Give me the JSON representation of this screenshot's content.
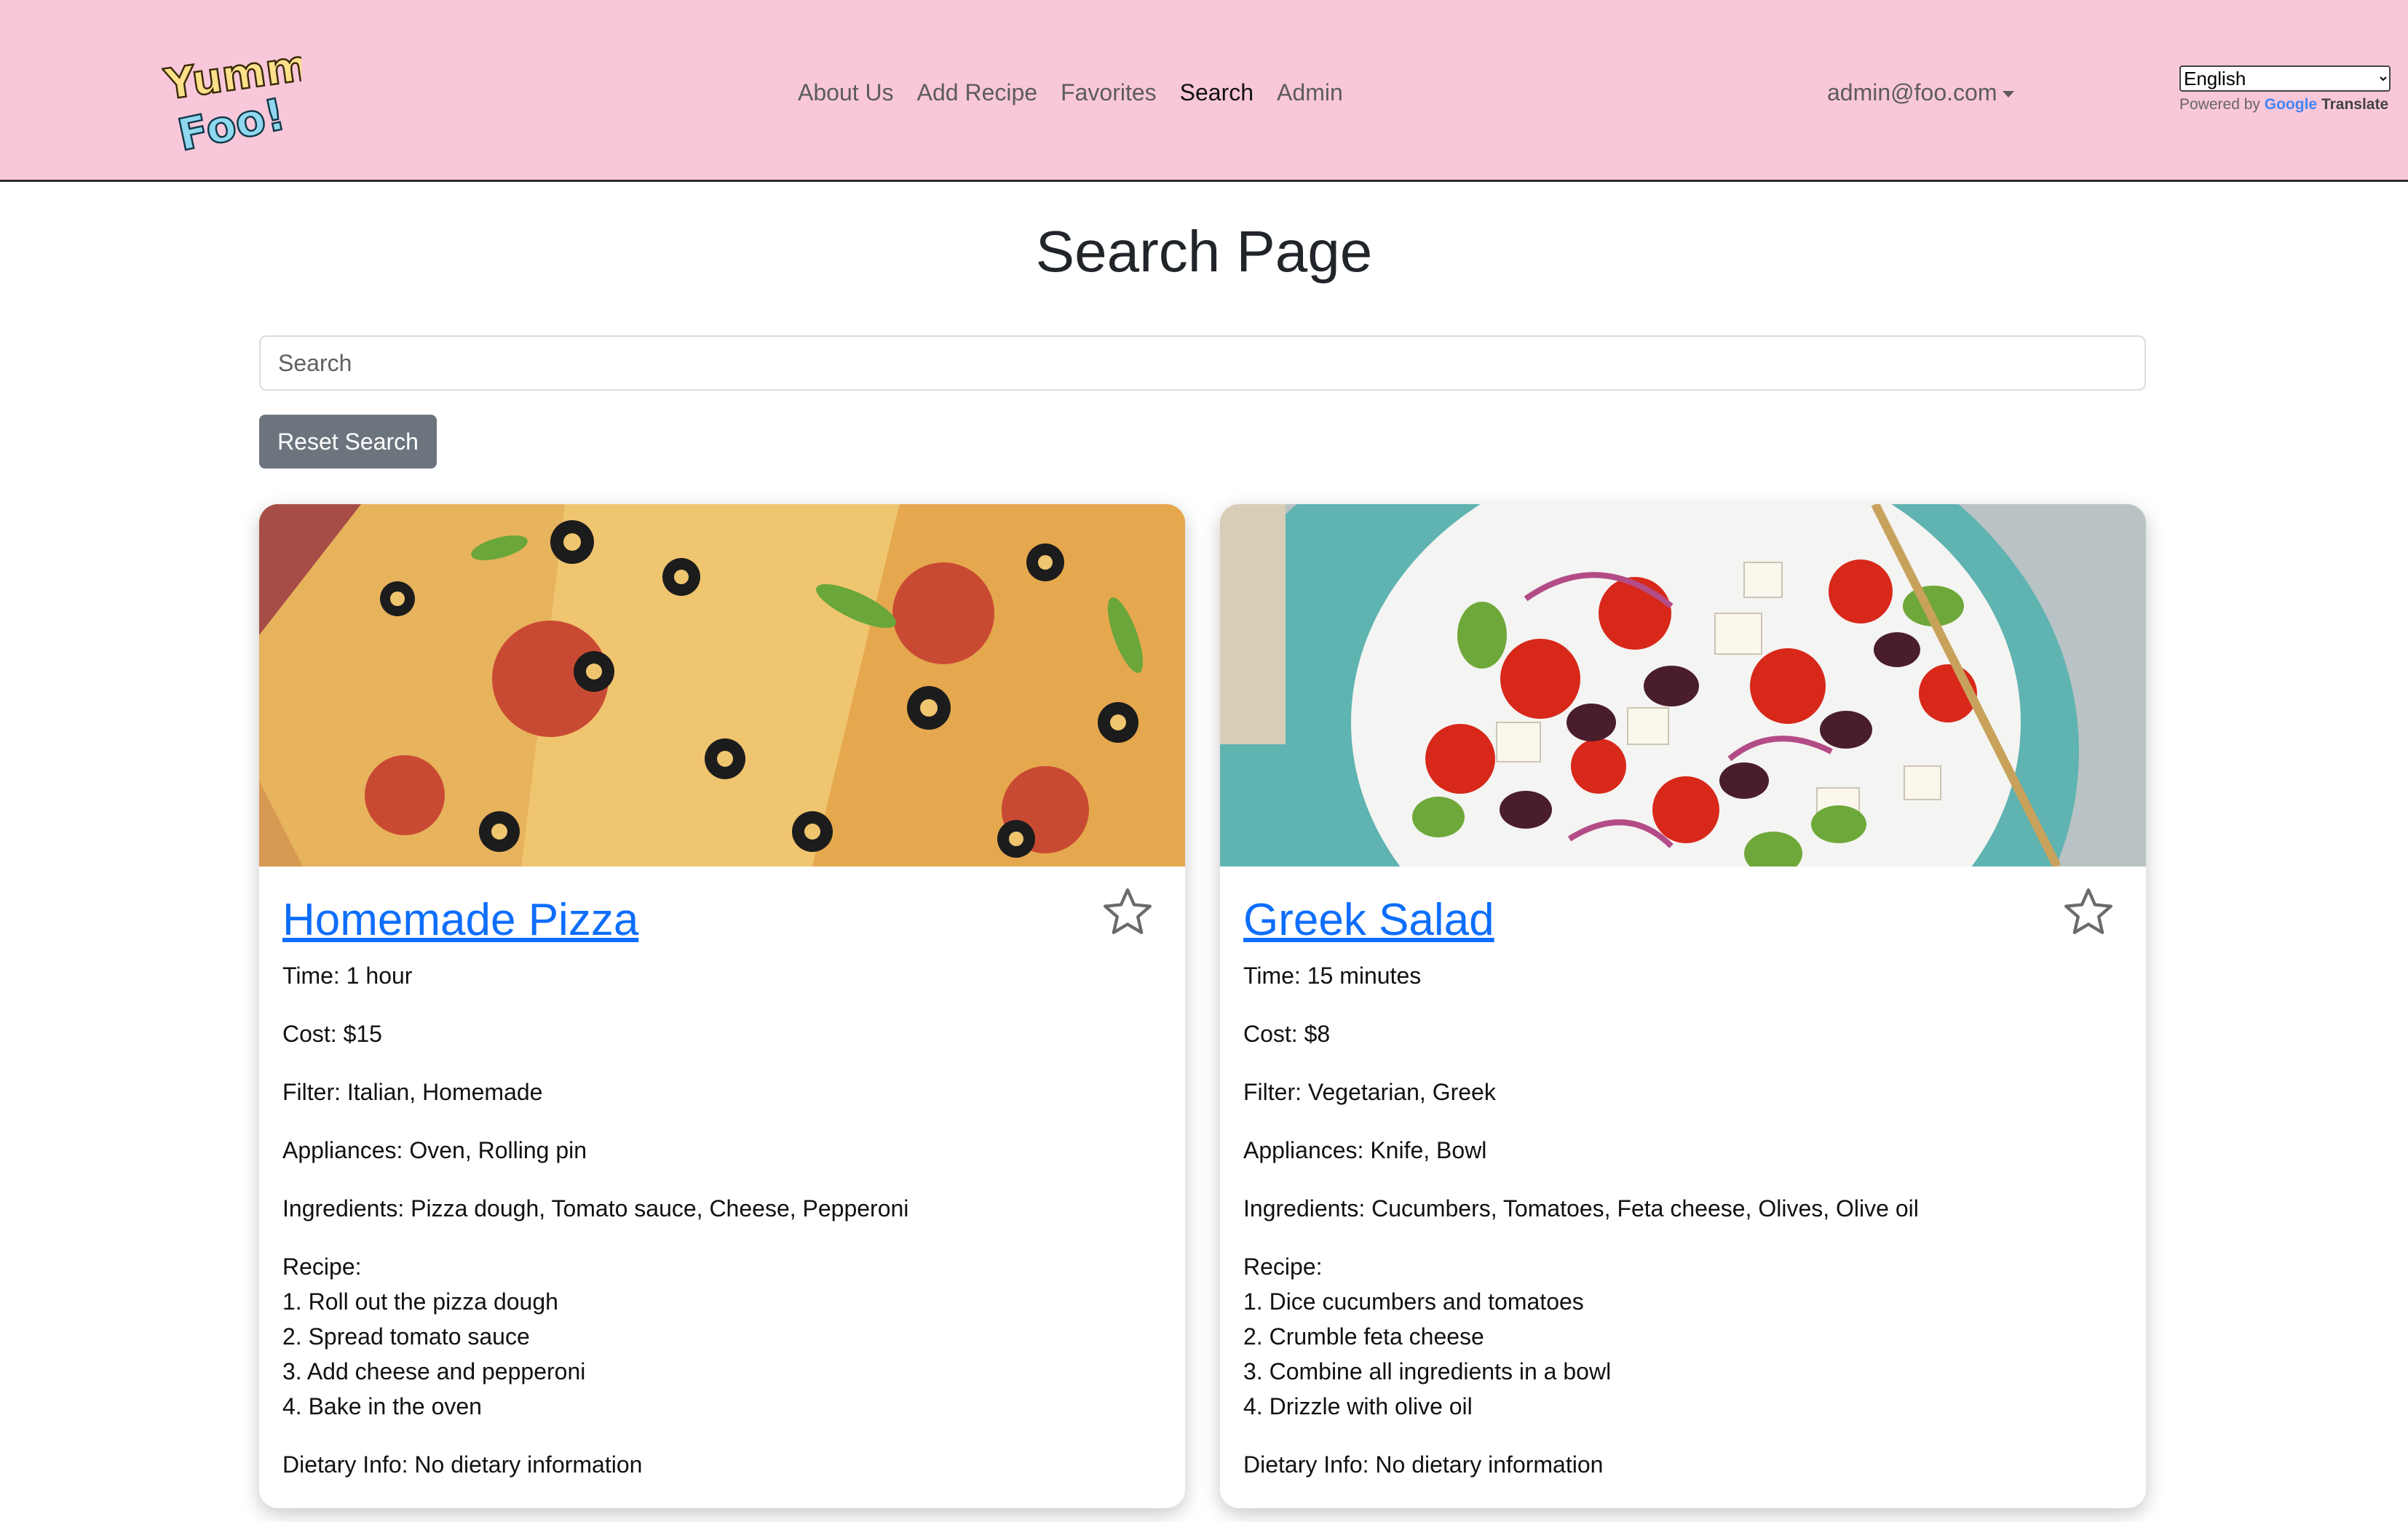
{
  "header": {
    "logo_text": "Yummy Foo!",
    "nav": [
      "About Us",
      "Add Recipe",
      "Favorites",
      "Search",
      "Admin"
    ],
    "active_nav": "Search",
    "user_email": "admin@foo.com",
    "language": {
      "selected": "English",
      "powered_by": "Powered by",
      "google": "Google",
      "translate": "Translate"
    }
  },
  "page": {
    "title": "Search Page",
    "search_placeholder": "Search",
    "reset_label": "Reset Search"
  },
  "cards": [
    {
      "title": "Homemade Pizza",
      "image_icon": "pizza-photo",
      "time": "Time: 1 hour",
      "cost": "Cost: $15",
      "filter": "Filter: Italian, Homemade",
      "appliances": "Appliances: Oven, Rolling pin",
      "ingredients": "Ingredients: Pizza dough, Tomato sauce, Cheese, Pepperoni",
      "recipe_label": "Recipe:",
      "steps": [
        "1. Roll out the pizza dough",
        "2. Spread tomato sauce",
        "3. Add cheese and pepperoni",
        "4. Bake in the oven"
      ],
      "dietary": "Dietary Info: No dietary information"
    },
    {
      "title": "Greek Salad",
      "image_icon": "salad-photo",
      "time": "Time: 15 minutes",
      "cost": "Cost: $8",
      "filter": "Filter: Vegetarian, Greek",
      "appliances": "Appliances: Knife, Bowl",
      "ingredients": "Ingredients: Cucumbers, Tomatoes, Feta cheese, Olives, Olive oil",
      "recipe_label": "Recipe:",
      "steps": [
        "1. Dice cucumbers and tomatoes",
        "2. Crumble feta cheese",
        "3. Combine all ingredients in a bowl",
        "4. Drizzle with olive oil"
      ],
      "dietary": "Dietary Info: No dietary information"
    }
  ],
  "colors": {
    "navbar_bg": "#f9c7da",
    "link_blue": "#0d6efd",
    "button_gray": "#6c757d"
  }
}
